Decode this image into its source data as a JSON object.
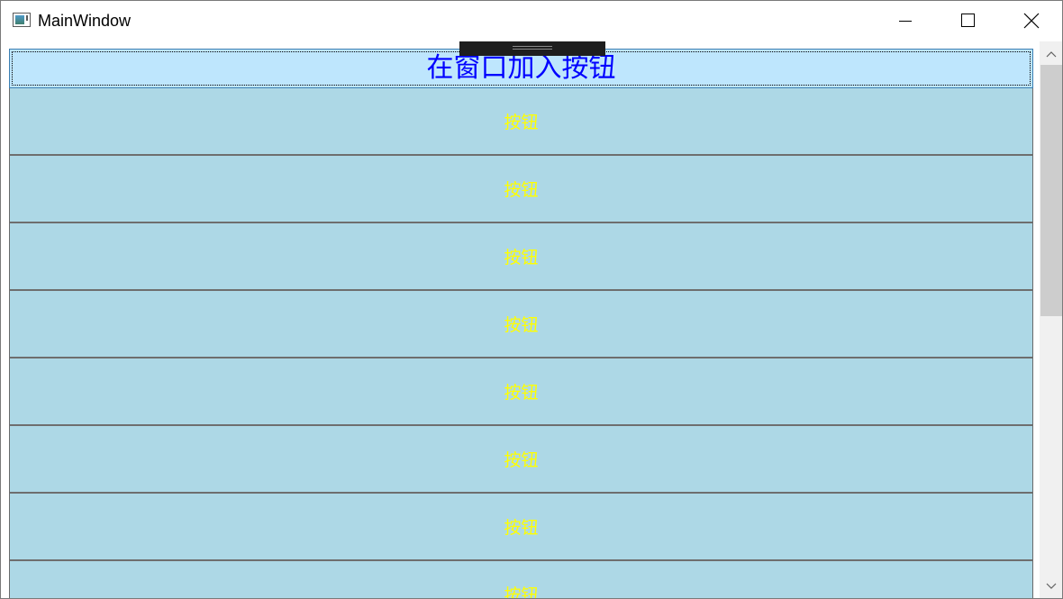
{
  "window": {
    "title": "MainWindow",
    "icon": "app-window-icon",
    "controls": {
      "minimize_icon": "minimize-icon",
      "maximize_icon": "maximize-icon",
      "close_icon": "close-icon"
    }
  },
  "main": {
    "header_button": {
      "label": "在窗口加入按钮",
      "background": "#bee6fd",
      "text_color": "#0000ff"
    },
    "buttons": [
      {
        "label": "按钮"
      },
      {
        "label": "按钮"
      },
      {
        "label": "按钮"
      },
      {
        "label": "按钮"
      },
      {
        "label": "按钮"
      },
      {
        "label": "按钮"
      },
      {
        "label": "按钮"
      },
      {
        "label": "按钮"
      }
    ],
    "button_style": {
      "background": "#add8e6",
      "text_color": "#ffff00"
    }
  },
  "scrollbar": {
    "up_icon": "chevron-up-icon",
    "down_icon": "chevron-down-icon"
  }
}
